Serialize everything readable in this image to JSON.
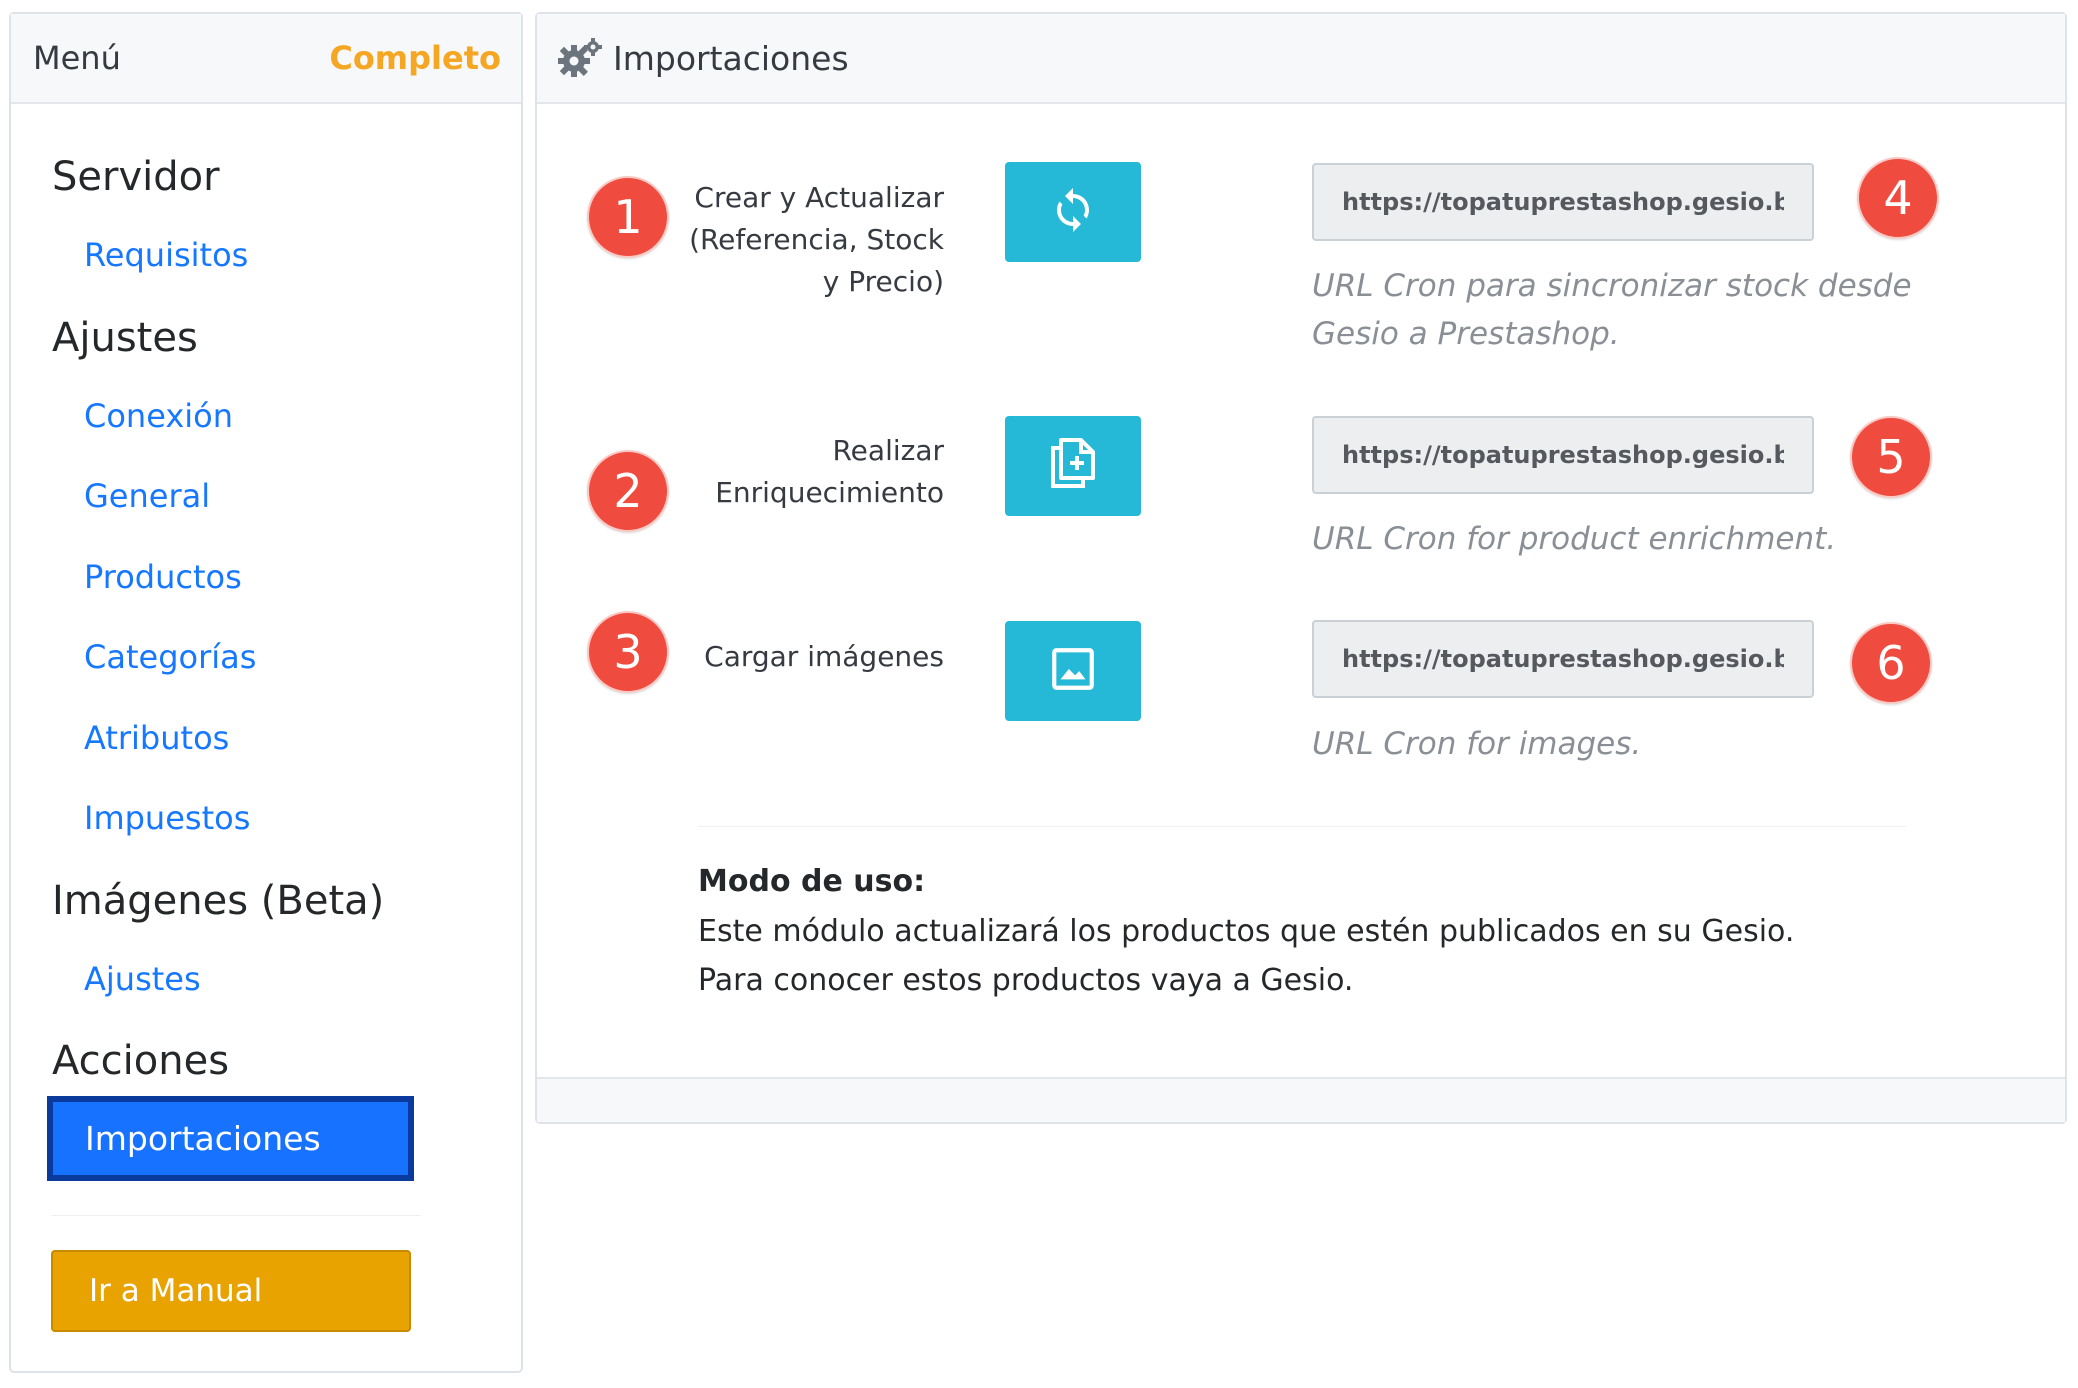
{
  "sidebar": {
    "title": "Menú",
    "status": "Completo",
    "sections": [
      {
        "title": "Servidor",
        "items": [
          "Requisitos"
        ]
      },
      {
        "title": "Ajustes",
        "items": [
          "Conexión",
          "General",
          "Productos",
          "Categorías",
          "Atributos",
          "Impuestos"
        ]
      },
      {
        "title": "Imágenes (Beta)",
        "items": [
          "Ajustes"
        ]
      },
      {
        "title": "Acciones",
        "items": [
          "Importaciones"
        ]
      }
    ],
    "manual_button": "Ir a Manual"
  },
  "panel": {
    "title": "Importaciones",
    "icon": "gears-icon",
    "rows": [
      {
        "badge": "1",
        "label_lines": [
          "Crear y Actualizar",
          "(Referencia, Stock",
          "y Precio)"
        ],
        "icon": "sync-icon",
        "url": "https://topatuprestashop.gesio.be/modules/gesio/cron.php",
        "url_badge": "4",
        "help_lines": [
          "URL Cron para sincronizar stock desde",
          "Gesio a Prestashop."
        ]
      },
      {
        "badge": "2",
        "label_lines": [
          "Realizar",
          "Enriquecimiento"
        ],
        "icon": "note-add-icon",
        "url": "https://topatuprestashop.gesio.be/modules/gesio/enrichment.php",
        "url_badge": "5",
        "help_lines": [
          "URL Cron for product enrichment."
        ]
      },
      {
        "badge": "3",
        "label_lines": [
          "Cargar imágenes"
        ],
        "icon": "image-icon",
        "url": "https://topatuprestashop.gesio.be/modules/gesio/images.php",
        "url_badge": "6",
        "help_lines": [
          "URL Cron for images."
        ]
      }
    ],
    "usage": {
      "title": "Modo de uso:",
      "lines": [
        "Este módulo actualizará los productos que estén publicados en su Gesio.",
        "Para conocer estos productos vaya a Gesio."
      ]
    }
  },
  "colors": {
    "link": "#1677ff",
    "accent_orange": "#f5a623",
    "action_blue": "#25b9d7",
    "badge_red": "#ef4b3f",
    "active_blue": "#1672ff",
    "manual_button": "#e8a300"
  }
}
